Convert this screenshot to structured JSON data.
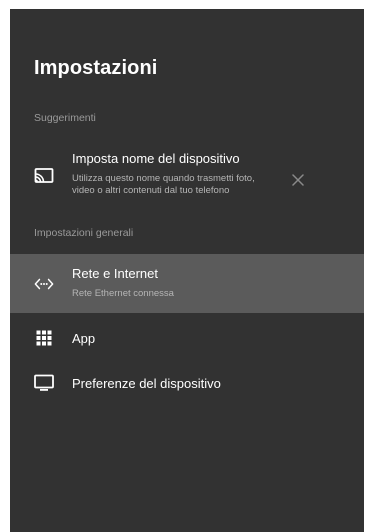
{
  "page_title": "Impostazioni",
  "suggestions": {
    "section_label": "Suggerimenti",
    "item": {
      "title": "Imposta nome del dispositivo",
      "subtitle_line1": "Utilizza questo nome quando trasmetti foto,",
      "subtitle_line2": "video o altri contenuti dal tuo telefono",
      "icon": "cast-icon",
      "dismiss_icon": "close-icon"
    }
  },
  "general": {
    "section_label": "Impostazioni generali",
    "items": [
      {
        "label": "Rete e Internet",
        "subtitle": "Rete Ethernet connessa",
        "icon": "network-icon",
        "selected": true
      },
      {
        "label": "App",
        "icon": "apps-grid-icon",
        "selected": false
      },
      {
        "label": "Preferenze del dispositivo",
        "icon": "tv-icon",
        "selected": false
      }
    ]
  },
  "colors": {
    "panel_background": "#323232",
    "selected_row": "#5b5b5b",
    "secondary_text": "#b5b5b5",
    "section_label": "#9a9a9a"
  }
}
